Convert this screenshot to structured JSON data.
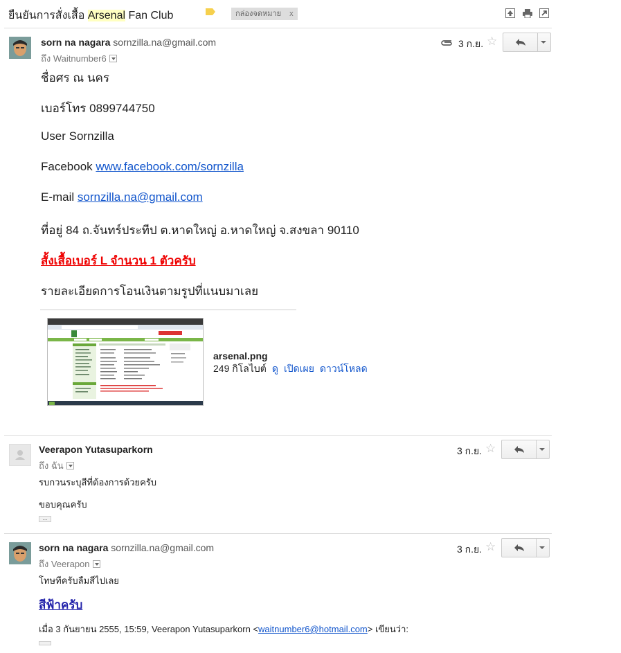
{
  "thread": {
    "subject_pre": "ยืนยันการสั่งเสื้อ ",
    "subject_highlight": "Arsenal",
    "subject_post": " Fan Club",
    "label": "กล่องจดหมาย",
    "label_close": "x",
    "label_color": "#f6d04d"
  },
  "toolbar_icons": [
    "expand-all-icon",
    "print-icon",
    "new-window-icon"
  ],
  "messages": [
    {
      "sender_name": "sorn na nagara",
      "sender_email": "sornzilla.na@gmail.com",
      "to_prefix": "ถึง",
      "to": "Waitnumber6",
      "date": "3 ก.ย.",
      "has_attachment": true,
      "body": {
        "name_line": "ชื่อศร  ณ นคร",
        "phone_line": "เบอร์โทร 0899744750",
        "user_line": "User Sornzilla",
        "facebook_label": "Facebook ",
        "facebook_link": "www.facebook.com/sornzilla",
        "email_label": "E-mail ",
        "email_link": "sornzilla.na@gmail.com",
        "address_line": "ที่อยู่ 84 ถ.จันทร์ประทีป ต.หาดใหญ่ อ.หาดใหญ่ จ.สงขลา 90110",
        "order_line": "สั้งเสื้อเบอร์ L จำนวน 1 ตัวครับ",
        "transfer_line": "รายละเอียดการโอนเงินตามรูปที่แนบมาเลย"
      },
      "attachment": {
        "filename": "arsenal.png",
        "size": "249 กิโลไบต์",
        "actions": [
          "ดู",
          "เปิดเผย",
          "ดาวน์โหลด"
        ]
      }
    },
    {
      "sender_name": "Veerapon Yutasuparkorn",
      "to_prefix": "ถึง",
      "to": "ฉัน",
      "date": "3 ก.ย.",
      "body": {
        "line1": "รบกวนระบุสีที่ต้องการด้วยครับ",
        "line2": "ขอบคุณครับ"
      }
    },
    {
      "sender_name": "sorn na nagara",
      "sender_email": "sornzilla.na@gmail.com",
      "to_prefix": "ถึง",
      "to": "Veerapon",
      "date": "3 ก.ย.",
      "body": {
        "line1": "โทษทีครับลืมสีไปเลย",
        "color_line": "สีฟ้าครับ",
        "quote_pre": "เมื่อ 3 กันยายน 2555, 15:59, Veerapon Yutasuparkorn <",
        "quote_email": "waitnumber6@hotmail.com",
        "quote_post": "> เขียนว่า:"
      }
    }
  ]
}
